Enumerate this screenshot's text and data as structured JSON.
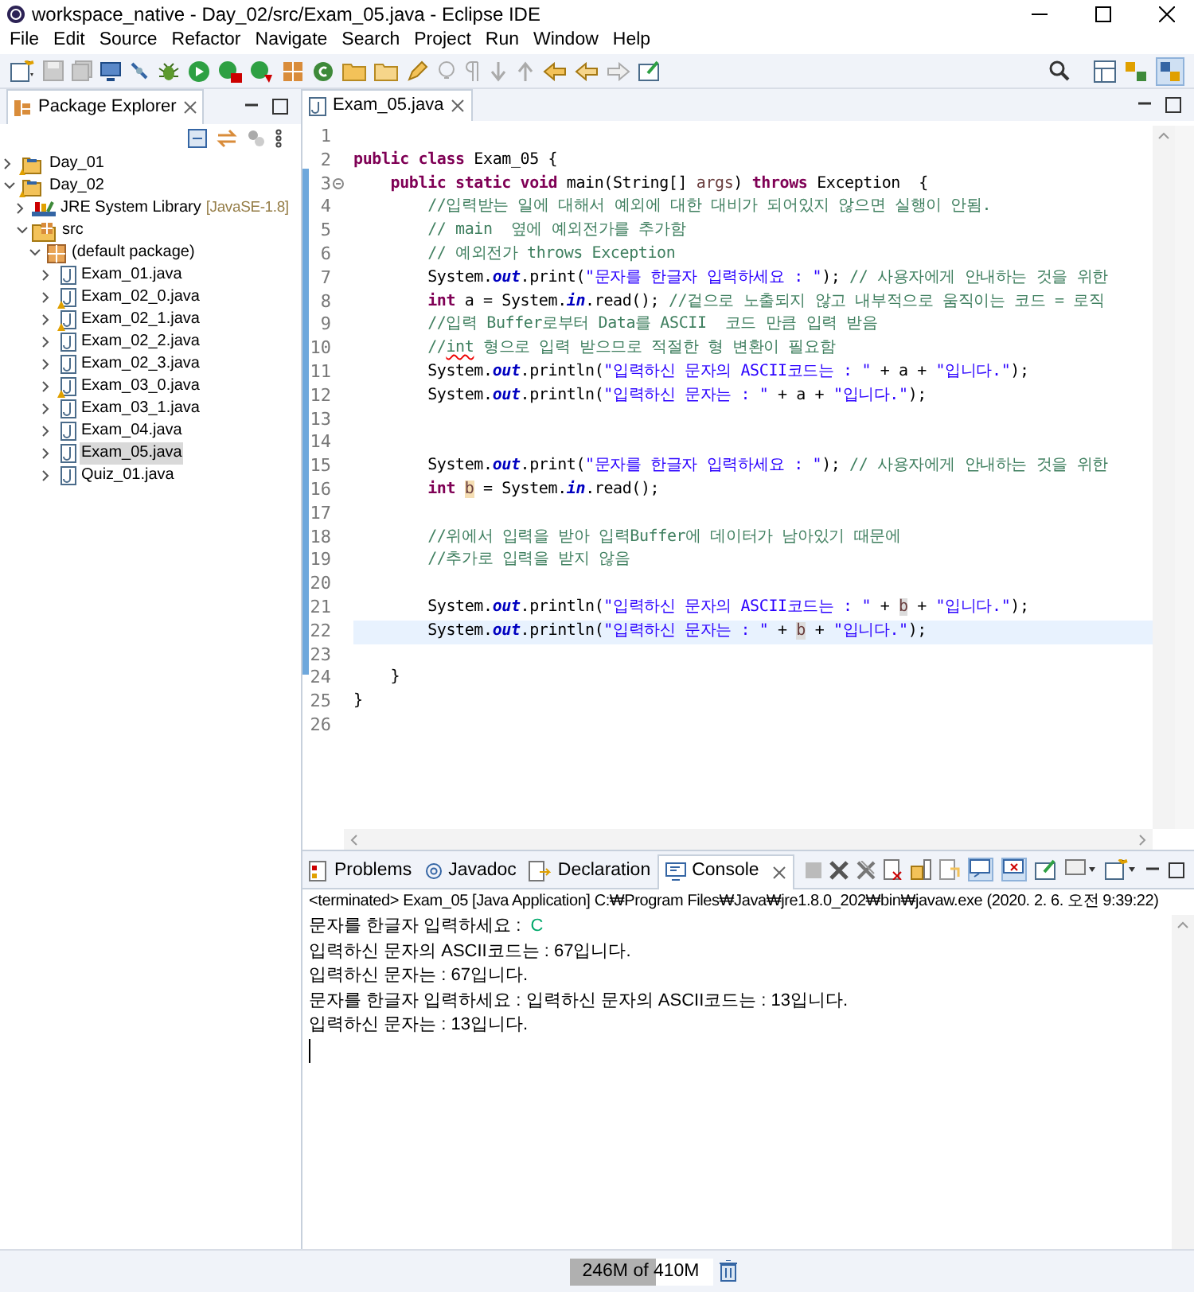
{
  "window": {
    "title": "workspace_native - Day_02/src/Exam_05.java - Eclipse IDE"
  },
  "menu": [
    "File",
    "Edit",
    "Source",
    "Refactor",
    "Navigate",
    "Search",
    "Project",
    "Run",
    "Window",
    "Help"
  ],
  "package_explorer": {
    "title": "Package Explorer",
    "tree": [
      {
        "label": "Day_01",
        "kind": "project",
        "expanded": false,
        "selected": false
      },
      {
        "label": "Day_02",
        "kind": "project",
        "expanded": true,
        "selected": false,
        "children": [
          {
            "label": "JRE System Library",
            "decoration": "[JavaSE-1.8]",
            "kind": "library",
            "expanded": false,
            "selected": false
          },
          {
            "label": "src",
            "kind": "source",
            "expanded": true,
            "selected": false,
            "children": [
              {
                "label": "(default package)",
                "kind": "package",
                "expanded": true,
                "selected": false,
                "children": [
                  {
                    "label": "Exam_01.java",
                    "kind": "file",
                    "warning": false,
                    "expanded": false,
                    "selected": false
                  },
                  {
                    "label": "Exam_02_0.java",
                    "kind": "file",
                    "warning": true,
                    "expanded": false,
                    "selected": false
                  },
                  {
                    "label": "Exam_02_1.java",
                    "kind": "file",
                    "warning": true,
                    "expanded": false,
                    "selected": false
                  },
                  {
                    "label": "Exam_02_2.java",
                    "kind": "file",
                    "warning": false,
                    "expanded": false,
                    "selected": false
                  },
                  {
                    "label": "Exam_02_3.java",
                    "kind": "file",
                    "warning": false,
                    "expanded": false,
                    "selected": false
                  },
                  {
                    "label": "Exam_03_0.java",
                    "kind": "file",
                    "warning": true,
                    "expanded": false,
                    "selected": false
                  },
                  {
                    "label": "Exam_03_1.java",
                    "kind": "file",
                    "warning": false,
                    "expanded": false,
                    "selected": false
                  },
                  {
                    "label": "Exam_04.java",
                    "kind": "file",
                    "warning": false,
                    "expanded": false,
                    "selected": false
                  },
                  {
                    "label": "Exam_05.java",
                    "kind": "file",
                    "warning": false,
                    "expanded": false,
                    "selected": true
                  },
                  {
                    "label": "Quiz_01.java",
                    "kind": "file",
                    "warning": false,
                    "expanded": false,
                    "selected": false
                  }
                ]
              }
            ]
          }
        ]
      }
    ]
  },
  "editor": {
    "tab": "Exam_05.java",
    "lines": [
      {
        "no": "1",
        "current": false
      },
      {
        "no": "2",
        "current": false,
        "tokens": [
          {
            "kind": "kw",
            "text": "public class "
          },
          {
            "kind": "plain",
            "text": "Exam_05 {"
          }
        ]
      },
      {
        "no": "3",
        "current": false,
        "fold": true,
        "tokens": [
          {
            "kind": "kw",
            "text": "    public static void "
          },
          {
            "kind": "plain",
            "text": "main(String[] "
          },
          {
            "kind": "var",
            "text": "args"
          },
          {
            "kind": "plain",
            "text": ") "
          },
          {
            "kind": "kw",
            "text": "throws "
          },
          {
            "kind": "plain",
            "text": "Exception  {"
          }
        ]
      },
      {
        "no": "4",
        "current": false,
        "tokens": [
          {
            "kind": "comment",
            "text": "        //입력받는 일에 대해서 예외에 대한 대비가 되어있지 않으면 실행이 안됨."
          }
        ]
      },
      {
        "no": "5",
        "current": false,
        "tokens": [
          {
            "kind": "comment",
            "text": "        // main  옆에 예외전가를 추가함"
          }
        ]
      },
      {
        "no": "6",
        "current": false,
        "tokens": [
          {
            "kind": "comment",
            "text": "        // 예외전가 throws Exception"
          }
        ]
      },
      {
        "no": "7",
        "current": false,
        "tokens": [
          {
            "kind": "plain",
            "text": "        System."
          },
          {
            "kind": "field",
            "text": "out"
          },
          {
            "kind": "plain",
            "text": ".print("
          },
          {
            "kind": "str",
            "text": "\"문자를 한글자 입력하세요 : \""
          },
          {
            "kind": "plain",
            "text": "); "
          },
          {
            "kind": "comment",
            "text": "// 사용자에게 안내하는 것을 위한"
          }
        ]
      },
      {
        "no": "8",
        "current": false,
        "tokens": [
          {
            "kind": "kw",
            "text": "        int "
          },
          {
            "kind": "plain",
            "text": "a = System."
          },
          {
            "kind": "field",
            "text": "in"
          },
          {
            "kind": "plain",
            "text": ".read(); "
          },
          {
            "kind": "comment",
            "text": "//겉으로 노출되지 않고 내부적으로 움직이는 코드 = 로직"
          }
        ]
      },
      {
        "no": "9",
        "current": false,
        "tokens": [
          {
            "kind": "comment",
            "text": "        //입력 Buffer로부터 Data를 ASCII  코드 만큼 입력 받음"
          }
        ]
      },
      {
        "no": "10",
        "current": false,
        "tokens": [
          {
            "kind": "comment",
            "text": "        //"
          },
          {
            "kind": "spell",
            "text": "int"
          },
          {
            "kind": "comment",
            "text": " 형으로 입력 받으므로 적절한 형 변환이 필요함"
          }
        ]
      },
      {
        "no": "11",
        "current": false,
        "tokens": [
          {
            "kind": "plain",
            "text": "        System."
          },
          {
            "kind": "field",
            "text": "out"
          },
          {
            "kind": "plain",
            "text": ".println("
          },
          {
            "kind": "str",
            "text": "\"입력하신 문자의 ASCII코드는 : \""
          },
          {
            "kind": "plain",
            "text": " + a + "
          },
          {
            "kind": "str",
            "text": "\"입니다.\""
          },
          {
            "kind": "plain",
            "text": ");"
          }
        ]
      },
      {
        "no": "12",
        "current": false,
        "tokens": [
          {
            "kind": "plain",
            "text": "        System."
          },
          {
            "kind": "field",
            "text": "out"
          },
          {
            "kind": "plain",
            "text": ".println("
          },
          {
            "kind": "str",
            "text": "\"입력하신 문자는 : \""
          },
          {
            "kind": "plain",
            "text": " + a + "
          },
          {
            "kind": "str",
            "text": "\"입니다.\""
          },
          {
            "kind": "plain",
            "text": ");"
          }
        ]
      },
      {
        "no": "13",
        "current": false
      },
      {
        "no": "14",
        "current": false
      },
      {
        "no": "15",
        "current": false,
        "tokens": [
          {
            "kind": "plain",
            "text": "        System."
          },
          {
            "kind": "field",
            "text": "out"
          },
          {
            "kind": "plain",
            "text": ".print("
          },
          {
            "kind": "str",
            "text": "\"문자를 한글자 입력하세요 : \""
          },
          {
            "kind": "plain",
            "text": "); "
          },
          {
            "kind": "comment",
            "text": "// 사용자에게 안내하는 것을 위한"
          }
        ]
      },
      {
        "no": "16",
        "current": false,
        "tokens": [
          {
            "kind": "kw",
            "text": "        int "
          },
          {
            "kind": "occ_write",
            "text": "b"
          },
          {
            "kind": "plain",
            "text": " = System."
          },
          {
            "kind": "field",
            "text": "in"
          },
          {
            "kind": "plain",
            "text": ".read();"
          }
        ]
      },
      {
        "no": "17",
        "current": false
      },
      {
        "no": "18",
        "current": false,
        "tokens": [
          {
            "kind": "comment",
            "text": "        //위에서 입력을 받아 입력Buffer에 데이터가 남아있기 때문에"
          }
        ]
      },
      {
        "no": "19",
        "current": false,
        "tokens": [
          {
            "kind": "comment",
            "text": "        //추가로 입력을 받지 않음"
          }
        ]
      },
      {
        "no": "20",
        "current": false
      },
      {
        "no": "21",
        "current": false,
        "tokens": [
          {
            "kind": "plain",
            "text": "        System."
          },
          {
            "kind": "field",
            "text": "out"
          },
          {
            "kind": "plain",
            "text": ".println("
          },
          {
            "kind": "str",
            "text": "\"입력하신 문자의 ASCII코드는 : \""
          },
          {
            "kind": "plain",
            "text": " + "
          },
          {
            "kind": "occ_read",
            "text": "b"
          },
          {
            "kind": "plain",
            "text": " + "
          },
          {
            "kind": "str",
            "text": "\"입니다.\""
          },
          {
            "kind": "plain",
            "text": ");"
          }
        ]
      },
      {
        "no": "22",
        "current": true,
        "tokens": [
          {
            "kind": "plain",
            "text": "        System."
          },
          {
            "kind": "field",
            "text": "out"
          },
          {
            "kind": "plain",
            "text": ".println("
          },
          {
            "kind": "str",
            "text": "\"입력하신 문자는 : \""
          },
          {
            "kind": "plain",
            "text": " + "
          },
          {
            "kind": "occ_read",
            "text": "b"
          },
          {
            "kind": "plain",
            "text": " + "
          },
          {
            "kind": "str",
            "text": "\"입니다.\""
          },
          {
            "kind": "plain",
            "text": ");"
          }
        ]
      },
      {
        "no": "23",
        "current": false
      },
      {
        "no": "24",
        "current": false,
        "tokens": [
          {
            "kind": "plain",
            "text": "    }"
          }
        ]
      },
      {
        "no": "25",
        "current": false,
        "tokens": [
          {
            "kind": "plain",
            "text": "}"
          }
        ]
      },
      {
        "no": "26",
        "current": false
      }
    ]
  },
  "bottom_panel": {
    "tabs": [
      {
        "label": "Problems",
        "kind": "problems",
        "selected": false
      },
      {
        "label": "Javadoc",
        "kind": "javadoc",
        "selected": false
      },
      {
        "label": "Declaration",
        "kind": "declaration",
        "selected": false
      },
      {
        "label": "Console",
        "kind": "console",
        "selected": true
      }
    ],
    "process": "<terminated> Exam_05 [Java Application] C:₩Program Files₩Java₩jre1.8.0_202₩bin₩javaw.exe (2020. 2. 6. 오전 9:39:22)",
    "output": [
      {
        "text": "문자를 한글자 입력하세요 : ",
        "input": "C"
      },
      {
        "text": "입력하신 문자의 ASCII코드는 : 67입니다."
      },
      {
        "text": "입력하신 문자는 : 67입니다."
      },
      {
        "text": "문자를 한글자 입력하세요 : 입력하신 문자의 ASCII코드는 : 13입니다."
      },
      {
        "text": "입력하신 문자는 : 13입니다."
      }
    ]
  },
  "status_bar": {
    "heap": "246M of 410M",
    "level": 0.6
  }
}
